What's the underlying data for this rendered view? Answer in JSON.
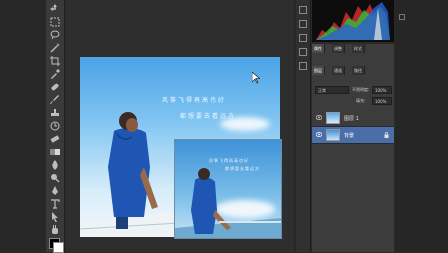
{
  "canvas": {
    "text_line_1": "风筝飞得再高也好",
    "text_line_2": "都想要去看远方",
    "inset_line_1": "风筝飞得再高也好",
    "inset_line_2": "都想要去看远方"
  },
  "panel": {
    "tabs": [
      "图层",
      "通道",
      "路径"
    ],
    "tabs_row2": [
      "属性",
      "调整",
      "样式"
    ],
    "blend_mode": "正常",
    "opacity_label": "不透明度:",
    "opacity_value": "100%",
    "fill_label": "填充:",
    "fill_value": "100%",
    "layers": [
      {
        "name": "图层 1",
        "selected": false
      },
      {
        "name": "背景",
        "selected": true
      }
    ]
  },
  "colors": {
    "accent": "#4a78c8",
    "panel_bg": "#3c3c3c",
    "selected_layer": "#4a6ea8"
  }
}
